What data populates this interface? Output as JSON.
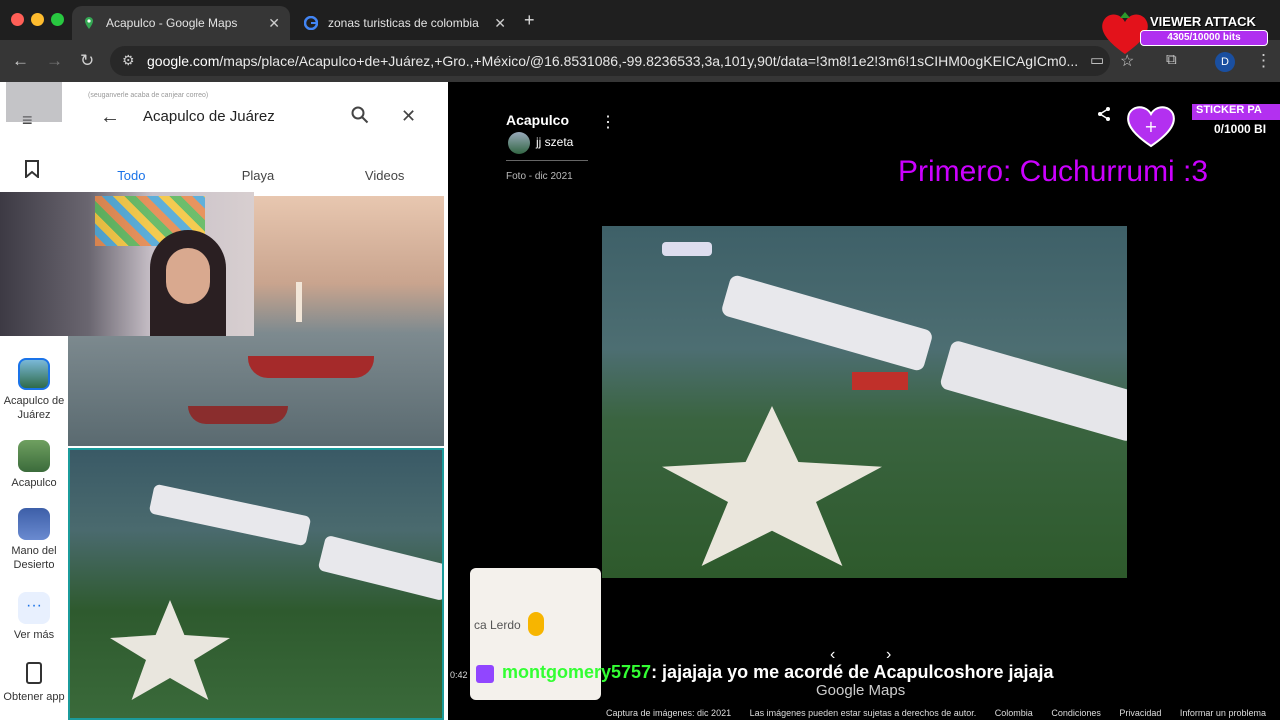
{
  "browser": {
    "tabs": [
      {
        "title": "Acapulco - Google Maps",
        "active": true
      },
      {
        "title": "zonas turisticas de colombia",
        "active": false
      }
    ],
    "url_host": "google.com",
    "url_path": "/maps/place/Acapulco+de+Juárez,+Gro.,+México/@16.8531086,-99.8236533,3a,101y,90t/data=!3m8!1e2!3m6!1sCIHM0ogKEICAgICm0...",
    "profile_initial": "D"
  },
  "stream_overlay": {
    "viewer_attack_label": "VIEWER ATTACK",
    "viewer_attack_progress": "4305/10000 bits",
    "sticker_label": "STICKER PA",
    "sticker_progress": "0/1000 BI",
    "first_text": "Primero: Cuchurrumi :3",
    "chat_user": "montgomery5757",
    "chat_message": ": jajajaja yo me acordé de Acapulcoshore jajaja",
    "chat_time": "0:42",
    "email_hint": "(seuganverle acaba de canjear correo)"
  },
  "maps": {
    "search_value": "Acapulco de Juárez",
    "filter_tabs": [
      "Todo",
      "Playa",
      "Videos"
    ],
    "active_filter": "Todo",
    "rail_items": [
      {
        "label": "Acapulco de Juárez"
      },
      {
        "label": "Acapulco"
      },
      {
        "label": "Mano del Desierto"
      },
      {
        "label": "Ver más"
      },
      {
        "label": "Obtener app"
      }
    ],
    "viewer": {
      "place_title": "Acapulco",
      "author": "jj szeta",
      "photo_date": "Foto - dic 2021",
      "minimap_label": "ca Lerdo",
      "watermark": "Google Maps"
    },
    "footer_links": [
      "Captura de imágenes: dic 2021",
      "Las imágenes pueden estar sujetas a derechos de autor.",
      "Colombia",
      "Condiciones",
      "Privacidad",
      "Informar un problema"
    ]
  },
  "colors": {
    "accent_blue": "#1a73e8",
    "overlay_magenta": "#cc00ff",
    "chat_user_green": "#33ff33"
  }
}
